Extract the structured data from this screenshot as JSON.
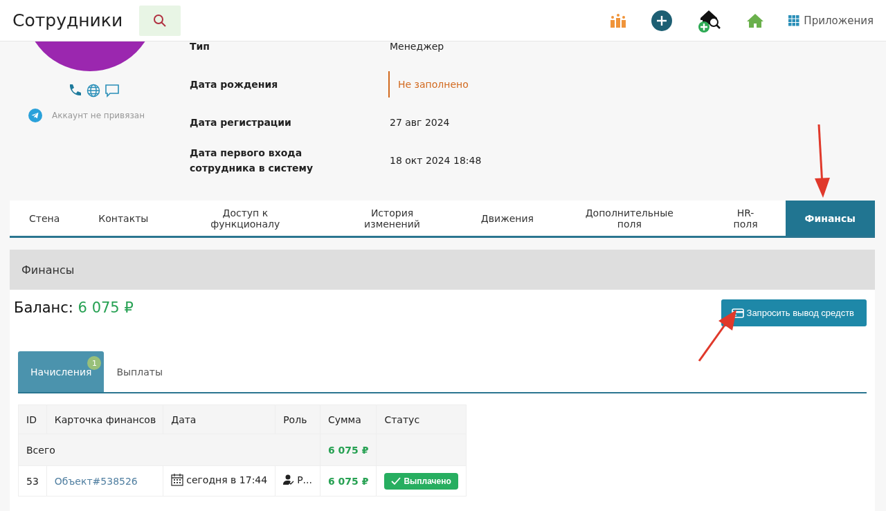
{
  "header": {
    "title": "Сотрудники",
    "apps_label": "Приложения"
  },
  "profile": {
    "telegram_status": "Аккаунт не привязан",
    "fields": [
      {
        "label": "Тип",
        "value": "Менеджер",
        "kind": "plain"
      },
      {
        "label": "Дата рождения",
        "value": "Не заполнено",
        "kind": "empty"
      },
      {
        "label": "Дата регистрации",
        "value": "27 авг 2024",
        "kind": "plain"
      },
      {
        "label": "Дата первого входа сотрудника в систему",
        "value": "18 окт 2024 18:48",
        "kind": "plain"
      }
    ]
  },
  "tabs": [
    {
      "label": "Стена",
      "selected": false
    },
    {
      "label": "Контакты",
      "selected": false
    },
    {
      "label": "Доступ к функционалу",
      "selected": false
    },
    {
      "label": "История изменений",
      "selected": false
    },
    {
      "label": "Движения",
      "selected": false
    },
    {
      "label": "Дополнительные поля",
      "selected": false
    },
    {
      "label": "HR-поля",
      "selected": false
    },
    {
      "label": "Финансы",
      "selected": true
    }
  ],
  "finance": {
    "title": "Финансы",
    "balance_label": "Баланс:",
    "balance_value": "6 075 ₽",
    "withdraw_button": "Запросить вывод средств",
    "subtabs": [
      {
        "label": "Начисления",
        "selected": true,
        "badge": "1"
      },
      {
        "label": "Выплаты",
        "selected": false
      }
    ],
    "table": {
      "columns": [
        "ID",
        "Карточка финансов",
        "Дата",
        "Роль",
        "Сумма",
        "Статус"
      ],
      "total": {
        "label": "Всего",
        "sum": "6 075 ₽"
      },
      "rows": [
        {
          "id": "53",
          "card": "Объект#538526",
          "date": "сегодня в 17:44",
          "role": "Р...",
          "sum": "6 075 ₽",
          "status": "Выплачено",
          "paid": true
        }
      ]
    }
  }
}
